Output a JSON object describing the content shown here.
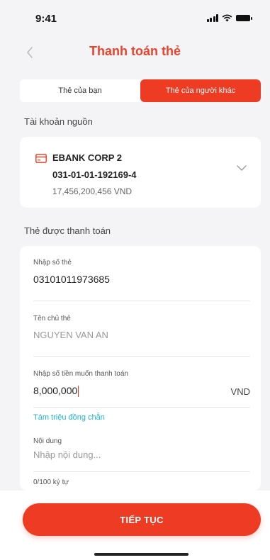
{
  "status_bar": {
    "time": "9:41"
  },
  "header": {
    "title": "Thanh toán thẻ"
  },
  "tabs": [
    {
      "label": "Thẻ của bạn",
      "active": false
    },
    {
      "label": "Thẻ của người khác",
      "active": true
    }
  ],
  "source_account": {
    "section_label": "Tài khoản nguồn",
    "name": "EBANK CORP 2",
    "number": "031-01-01-192169-4",
    "balance": "17,456,200,456 VND"
  },
  "payment_card": {
    "section_label": "Thẻ được thanh toán",
    "card_number_label": "Nhập số thẻ",
    "card_number_value": "03101011973685",
    "holder_label": "Tên chủ thẻ",
    "holder_value": "NGUYEN VAN AN",
    "amount_label": "Nhập số tiền muốn thanh toán",
    "amount_value": "8,000,000",
    "amount_unit": "VND",
    "amount_in_words": "Tám triệu đồng chẵn",
    "content_label": "Nội dung",
    "content_placeholder": "Nhập nội dung...",
    "char_counter": "0/100 ký tự"
  },
  "footer": {
    "continue_label": "TIẾP TỤC"
  },
  "colors": {
    "accent": "#ee3b23",
    "link": "#1fb5d0",
    "background": "#f4f4f6"
  },
  "icons": [
    "signal-icon",
    "wifi-icon",
    "battery-icon",
    "back-arrow-icon",
    "card-icon",
    "chevron-down-icon"
  ]
}
